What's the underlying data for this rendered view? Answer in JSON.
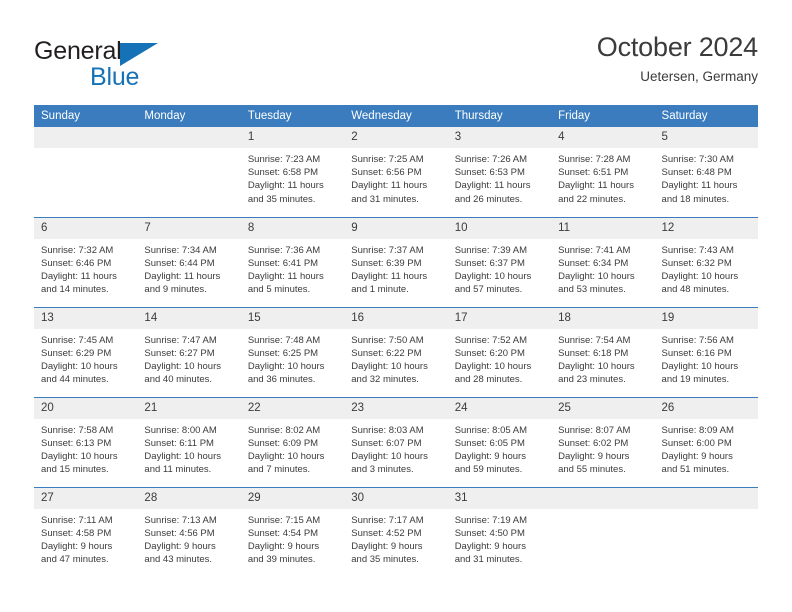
{
  "brand": {
    "line1": "General",
    "line2": "Blue",
    "triangle_color": "#1572b6"
  },
  "header": {
    "title": "October 2024",
    "subtitle": "Uetersen, Germany"
  },
  "theme": {
    "header_blue": "#3a7cbe",
    "daynum_band": "#efefef",
    "text": "#3b3b3b"
  },
  "weekday_headers": [
    "Sunday",
    "Monday",
    "Tuesday",
    "Wednesday",
    "Thursday",
    "Friday",
    "Saturday"
  ],
  "weeks": [
    [
      {
        "day": "",
        "sunrise": "",
        "sunset": "",
        "daylight1": "",
        "daylight2": ""
      },
      {
        "day": "",
        "sunrise": "",
        "sunset": "",
        "daylight1": "",
        "daylight2": ""
      },
      {
        "day": "1",
        "sunrise": "Sunrise: 7:23 AM",
        "sunset": "Sunset: 6:58 PM",
        "daylight1": "Daylight: 11 hours",
        "daylight2": "and 35 minutes."
      },
      {
        "day": "2",
        "sunrise": "Sunrise: 7:25 AM",
        "sunset": "Sunset: 6:56 PM",
        "daylight1": "Daylight: 11 hours",
        "daylight2": "and 31 minutes."
      },
      {
        "day": "3",
        "sunrise": "Sunrise: 7:26 AM",
        "sunset": "Sunset: 6:53 PM",
        "daylight1": "Daylight: 11 hours",
        "daylight2": "and 26 minutes."
      },
      {
        "day": "4",
        "sunrise": "Sunrise: 7:28 AM",
        "sunset": "Sunset: 6:51 PM",
        "daylight1": "Daylight: 11 hours",
        "daylight2": "and 22 minutes."
      },
      {
        "day": "5",
        "sunrise": "Sunrise: 7:30 AM",
        "sunset": "Sunset: 6:48 PM",
        "daylight1": "Daylight: 11 hours",
        "daylight2": "and 18 minutes."
      }
    ],
    [
      {
        "day": "6",
        "sunrise": "Sunrise: 7:32 AM",
        "sunset": "Sunset: 6:46 PM",
        "daylight1": "Daylight: 11 hours",
        "daylight2": "and 14 minutes."
      },
      {
        "day": "7",
        "sunrise": "Sunrise: 7:34 AM",
        "sunset": "Sunset: 6:44 PM",
        "daylight1": "Daylight: 11 hours",
        "daylight2": "and 9 minutes."
      },
      {
        "day": "8",
        "sunrise": "Sunrise: 7:36 AM",
        "sunset": "Sunset: 6:41 PM",
        "daylight1": "Daylight: 11 hours",
        "daylight2": "and 5 minutes."
      },
      {
        "day": "9",
        "sunrise": "Sunrise: 7:37 AM",
        "sunset": "Sunset: 6:39 PM",
        "daylight1": "Daylight: 11 hours",
        "daylight2": "and 1 minute."
      },
      {
        "day": "10",
        "sunrise": "Sunrise: 7:39 AM",
        "sunset": "Sunset: 6:37 PM",
        "daylight1": "Daylight: 10 hours",
        "daylight2": "and 57 minutes."
      },
      {
        "day": "11",
        "sunrise": "Sunrise: 7:41 AM",
        "sunset": "Sunset: 6:34 PM",
        "daylight1": "Daylight: 10 hours",
        "daylight2": "and 53 minutes."
      },
      {
        "day": "12",
        "sunrise": "Sunrise: 7:43 AM",
        "sunset": "Sunset: 6:32 PM",
        "daylight1": "Daylight: 10 hours",
        "daylight2": "and 48 minutes."
      }
    ],
    [
      {
        "day": "13",
        "sunrise": "Sunrise: 7:45 AM",
        "sunset": "Sunset: 6:29 PM",
        "daylight1": "Daylight: 10 hours",
        "daylight2": "and 44 minutes."
      },
      {
        "day": "14",
        "sunrise": "Sunrise: 7:47 AM",
        "sunset": "Sunset: 6:27 PM",
        "daylight1": "Daylight: 10 hours",
        "daylight2": "and 40 minutes."
      },
      {
        "day": "15",
        "sunrise": "Sunrise: 7:48 AM",
        "sunset": "Sunset: 6:25 PM",
        "daylight1": "Daylight: 10 hours",
        "daylight2": "and 36 minutes."
      },
      {
        "day": "16",
        "sunrise": "Sunrise: 7:50 AM",
        "sunset": "Sunset: 6:22 PM",
        "daylight1": "Daylight: 10 hours",
        "daylight2": "and 32 minutes."
      },
      {
        "day": "17",
        "sunrise": "Sunrise: 7:52 AM",
        "sunset": "Sunset: 6:20 PM",
        "daylight1": "Daylight: 10 hours",
        "daylight2": "and 28 minutes."
      },
      {
        "day": "18",
        "sunrise": "Sunrise: 7:54 AM",
        "sunset": "Sunset: 6:18 PM",
        "daylight1": "Daylight: 10 hours",
        "daylight2": "and 23 minutes."
      },
      {
        "day": "19",
        "sunrise": "Sunrise: 7:56 AM",
        "sunset": "Sunset: 6:16 PM",
        "daylight1": "Daylight: 10 hours",
        "daylight2": "and 19 minutes."
      }
    ],
    [
      {
        "day": "20",
        "sunrise": "Sunrise: 7:58 AM",
        "sunset": "Sunset: 6:13 PM",
        "daylight1": "Daylight: 10 hours",
        "daylight2": "and 15 minutes."
      },
      {
        "day": "21",
        "sunrise": "Sunrise: 8:00 AM",
        "sunset": "Sunset: 6:11 PM",
        "daylight1": "Daylight: 10 hours",
        "daylight2": "and 11 minutes."
      },
      {
        "day": "22",
        "sunrise": "Sunrise: 8:02 AM",
        "sunset": "Sunset: 6:09 PM",
        "daylight1": "Daylight: 10 hours",
        "daylight2": "and 7 minutes."
      },
      {
        "day": "23",
        "sunrise": "Sunrise: 8:03 AM",
        "sunset": "Sunset: 6:07 PM",
        "daylight1": "Daylight: 10 hours",
        "daylight2": "and 3 minutes."
      },
      {
        "day": "24",
        "sunrise": "Sunrise: 8:05 AM",
        "sunset": "Sunset: 6:05 PM",
        "daylight1": "Daylight: 9 hours",
        "daylight2": "and 59 minutes."
      },
      {
        "day": "25",
        "sunrise": "Sunrise: 8:07 AM",
        "sunset": "Sunset: 6:02 PM",
        "daylight1": "Daylight: 9 hours",
        "daylight2": "and 55 minutes."
      },
      {
        "day": "26",
        "sunrise": "Sunrise: 8:09 AM",
        "sunset": "Sunset: 6:00 PM",
        "daylight1": "Daylight: 9 hours",
        "daylight2": "and 51 minutes."
      }
    ],
    [
      {
        "day": "27",
        "sunrise": "Sunrise: 7:11 AM",
        "sunset": "Sunset: 4:58 PM",
        "daylight1": "Daylight: 9 hours",
        "daylight2": "and 47 minutes."
      },
      {
        "day": "28",
        "sunrise": "Sunrise: 7:13 AM",
        "sunset": "Sunset: 4:56 PM",
        "daylight1": "Daylight: 9 hours",
        "daylight2": "and 43 minutes."
      },
      {
        "day": "29",
        "sunrise": "Sunrise: 7:15 AM",
        "sunset": "Sunset: 4:54 PM",
        "daylight1": "Daylight: 9 hours",
        "daylight2": "and 39 minutes."
      },
      {
        "day": "30",
        "sunrise": "Sunrise: 7:17 AM",
        "sunset": "Sunset: 4:52 PM",
        "daylight1": "Daylight: 9 hours",
        "daylight2": "and 35 minutes."
      },
      {
        "day": "31",
        "sunrise": "Sunrise: 7:19 AM",
        "sunset": "Sunset: 4:50 PM",
        "daylight1": "Daylight: 9 hours",
        "daylight2": "and 31 minutes."
      },
      {
        "day": "",
        "sunrise": "",
        "sunset": "",
        "daylight1": "",
        "daylight2": ""
      },
      {
        "day": "",
        "sunrise": "",
        "sunset": "",
        "daylight1": "",
        "daylight2": ""
      }
    ]
  ]
}
